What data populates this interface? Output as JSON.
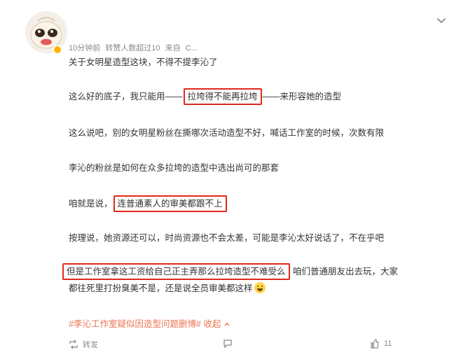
{
  "post": {
    "time": "10分钟前",
    "repost_note": "转赞人数超过10",
    "source_label": "来自",
    "source_name": "C...",
    "lines": [
      "关于女明星造型这块，不得不提李沁了",
      "这么好的底子，我只能用——",
      "拉垮得不能再拉垮",
      "——来形容她的造型",
      "这么说吧，别的女明星粉丝在撕哪次活动造型不好，喊话工作室的时候，次数有限",
      "李沁的粉丝是如何在众多拉垮的造型中选出尚可的那套",
      "咱就是说，",
      "连普通素人的审美都跟不上",
      "按理说，她资源还可以，时尚资源也不会太差，可能是李沁太好说话了，不在乎吧",
      "但是工作室拿这工资给自己正主弄那么拉垮造型不难受么",
      "咱们普通朋友出去玩，大家",
      "都往死里打扮臭美不是，还是说全员审美都这样"
    ],
    "hashtag": "#李沁工作室疑似因造型问题删博#",
    "collapse": "收起"
  },
  "footer": {
    "repost_label": "转发",
    "comment_count": "",
    "like_count": "11"
  },
  "icons": {
    "chevron": "chevron-down-icon",
    "avatar_badge": "verified-badge-icon",
    "emoji": "grin-emoji-icon",
    "collapse": "chevron-up-icon",
    "repost": "repost-icon",
    "comment": "comment-icon",
    "like": "like-icon"
  },
  "colors": {
    "highlight_border": "#e0281c",
    "hashtag": "#eb7350",
    "meta_text": "#8a8a8a"
  }
}
